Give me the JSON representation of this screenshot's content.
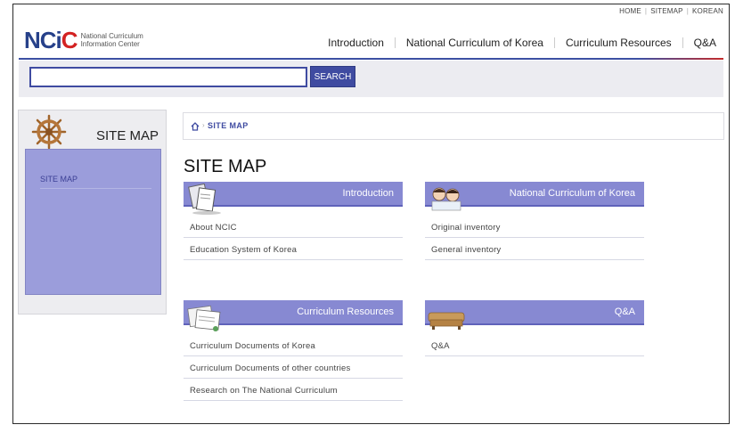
{
  "util_links": [
    "HOME",
    "SITEMAP",
    "KOREAN"
  ],
  "logo": {
    "mark": "NCIC",
    "line1": "National Curriculum",
    "line2": "Information Center"
  },
  "main_nav": [
    "Introduction",
    "National Curriculum of Korea",
    "Curriculum Resources",
    "Q&A"
  ],
  "search": {
    "placeholder": "",
    "button_label": "SEARCH"
  },
  "sidebar": {
    "title": "SITE MAP",
    "items": [
      "SITE MAP"
    ]
  },
  "breadcrumb": {
    "current": "SITE MAP"
  },
  "page_title": "SITE MAP",
  "sections": [
    {
      "title": "Introduction",
      "icon": "book-icon",
      "links": [
        "About NCIC",
        "Education System of Korea"
      ]
    },
    {
      "title": "National Curriculum  of Korea",
      "icon": "children-icon",
      "links": [
        "Original inventory",
        "General inventory"
      ]
    },
    {
      "title": "Curriculum Resources",
      "icon": "documents-icon",
      "links": [
        "Curriculum Documents of Korea",
        "Curriculum Documents of other countries",
        "Research on The National Curriculum"
      ]
    },
    {
      "title": "Q&A",
      "icon": "sofa-icon",
      "links": [
        "Q&A"
      ]
    }
  ],
  "colors": {
    "brand_blue": "#3f4ba1",
    "brand_red": "#d32222",
    "section_header": "#8789d2",
    "sidebar_menu": "#9b9ddb"
  }
}
